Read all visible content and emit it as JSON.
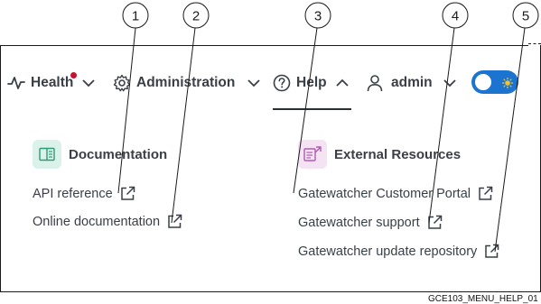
{
  "navbar": {
    "health": {
      "label": "Health",
      "icon": "pulse-icon",
      "alert_dot_color": "#c0152c"
    },
    "administration": {
      "label": "Administration",
      "icon": "gear-icon"
    },
    "help": {
      "label": "Help",
      "icon": "question-circle-icon",
      "expanded": true
    },
    "user": {
      "label": "admin",
      "icon": "user-icon"
    },
    "theme_toggle": {
      "icon": "sun-icon",
      "color": "#1b75d0"
    }
  },
  "help_menu": {
    "documentation": {
      "title": "Documentation",
      "icon": "book-icon",
      "links": [
        {
          "label": "API reference"
        },
        {
          "label": "Online documentation"
        }
      ]
    },
    "external_resources": {
      "title": "External Resources",
      "icon": "external-resources-icon",
      "links": [
        {
          "label": "Gatewatcher Customer Portal"
        },
        {
          "label": "Gatewatcher support"
        },
        {
          "label": "Gatewatcher update repository"
        }
      ]
    }
  },
  "callouts": [
    "1",
    "2",
    "3",
    "4",
    "5"
  ],
  "figure_ref": "GCE103_MENU_HELP_01"
}
